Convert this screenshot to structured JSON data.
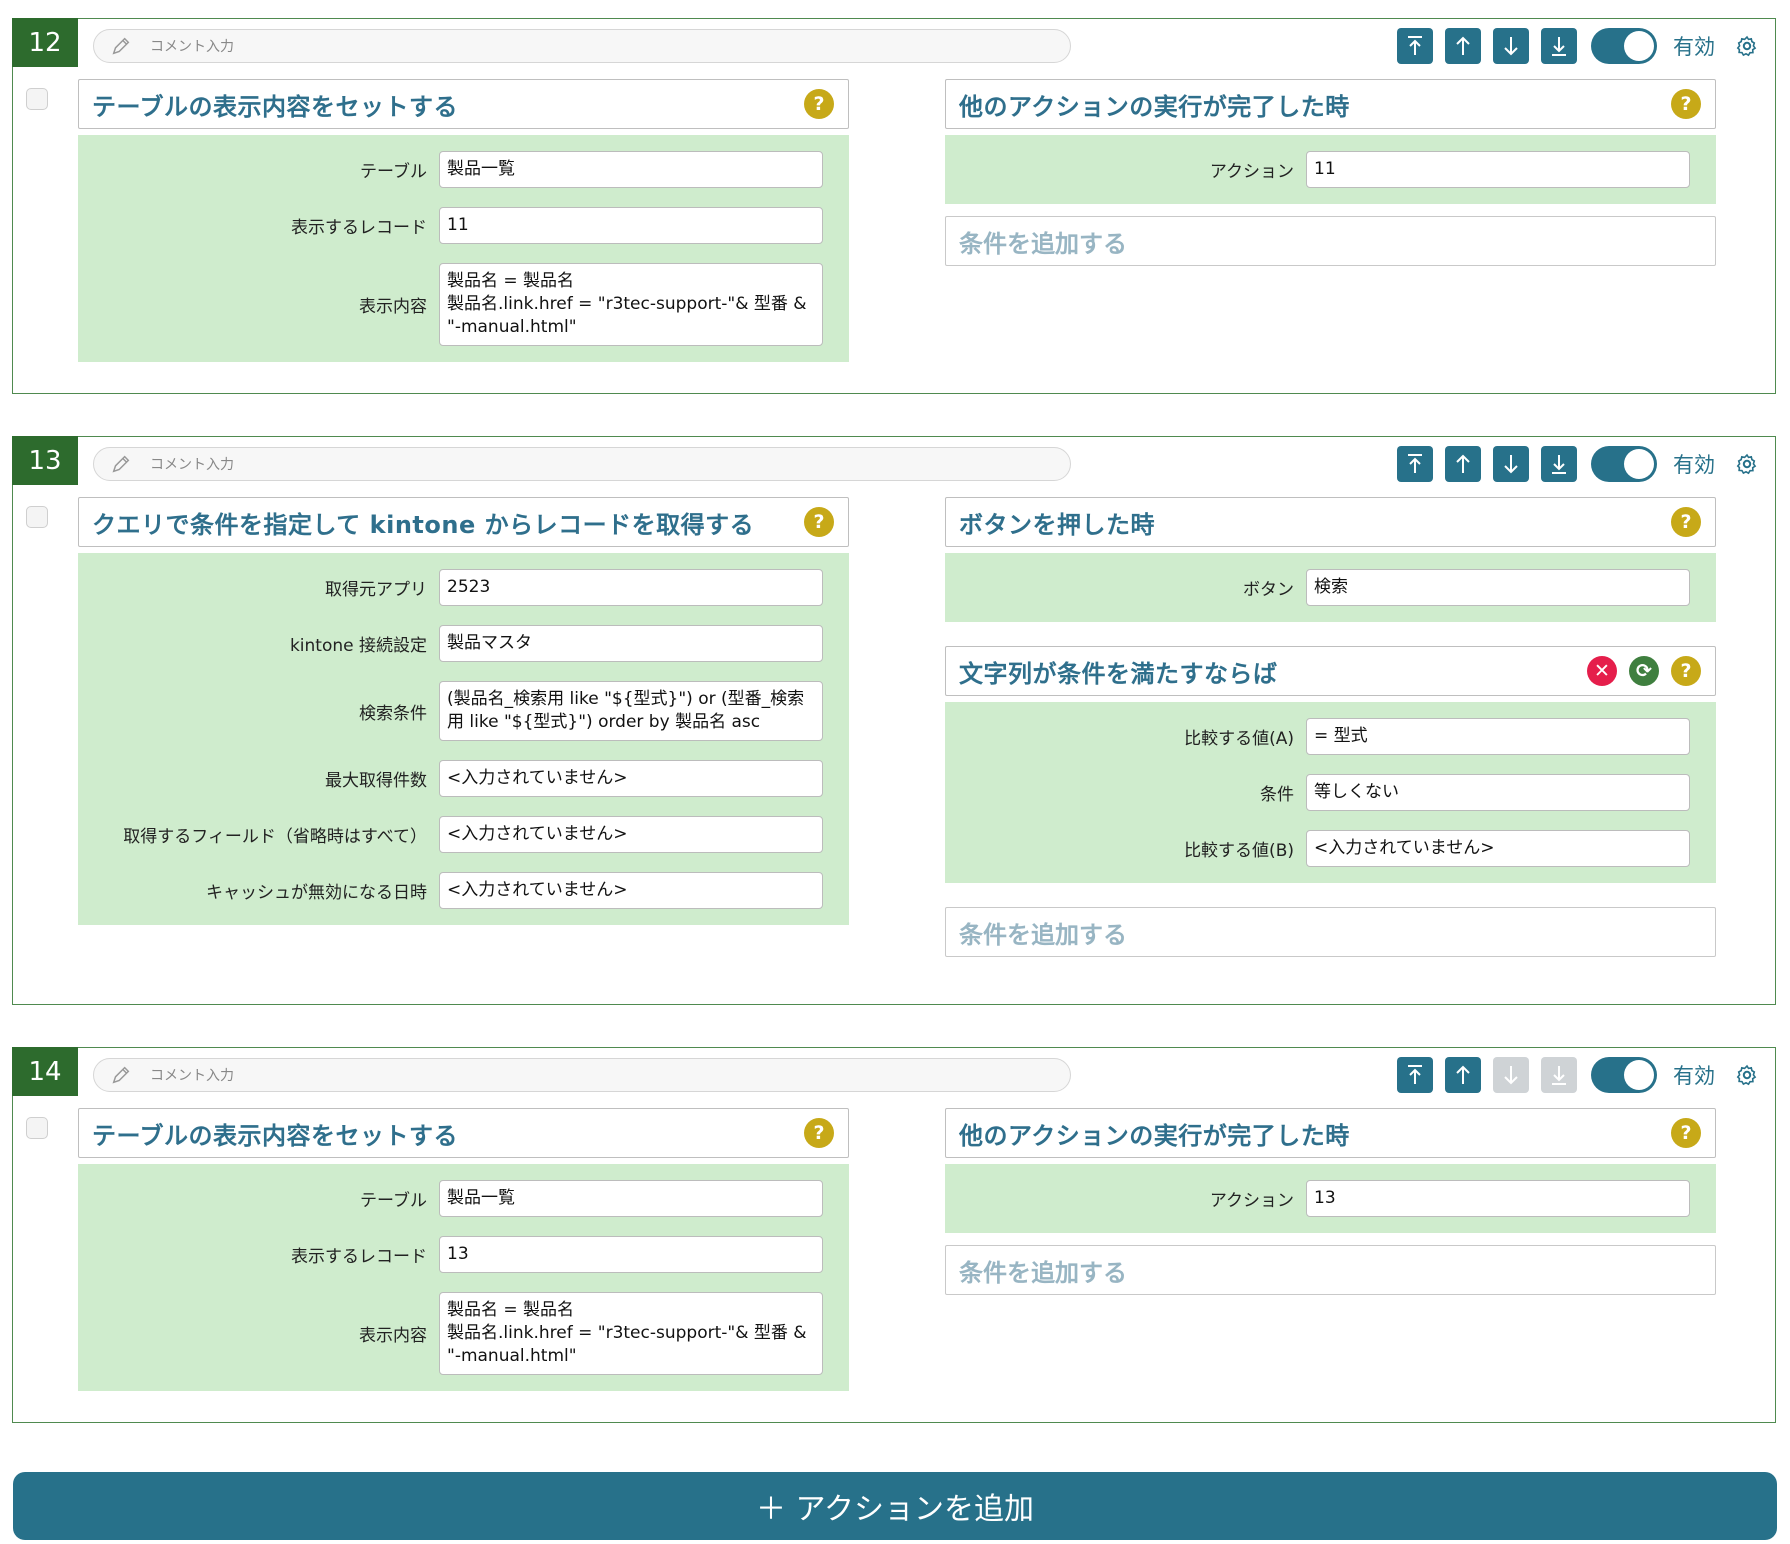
{
  "comment_placeholder": "コメント入力",
  "toggle_label": "有効",
  "add_condition_label": "条件を追加する",
  "add_action_label": "＋ アクションを追加",
  "colors": {
    "accent": "#27718a",
    "badge": "#2d6b2d",
    "panel_bg": "#cfeccd",
    "help": "#c7a918",
    "delete": "#e51e4b"
  },
  "actions": [
    {
      "number": "12",
      "enabled": true,
      "action": {
        "title": "テーブルの表示内容をセットする",
        "fields": [
          {
            "label": "テーブル",
            "value": "製品一覧"
          },
          {
            "label": "表示するレコード",
            "value": "11"
          },
          {
            "label": "表示内容",
            "value": "製品名 = 製品名\n製品名.link.href = \"r3tec-support-\"& 型番 & \"-manual.html\""
          }
        ]
      },
      "trigger": {
        "title": "他のアクションの実行が完了した時",
        "fields": [
          {
            "label": "アクション",
            "value": "11"
          }
        ]
      }
    },
    {
      "number": "13",
      "enabled": true,
      "action": {
        "title": "クエリで条件を指定して kintone からレコードを取得する",
        "fields": [
          {
            "label": "取得元アプリ",
            "value": "2523"
          },
          {
            "label": "kintone 接続設定",
            "value": "製品マスタ"
          },
          {
            "label": "検索条件",
            "value": "(製品名_検索用 like \"${型式}\") or (型番_検索用 like \"${型式}\") order by 製品名 asc"
          },
          {
            "label": "最大取得件数",
            "value": "<入力されていません>"
          },
          {
            "label": "取得するフィールド（省略時はすべて）",
            "value": "<入力されていません>"
          },
          {
            "label": "キャッシュが無効になる日時",
            "value": "<入力されていません>"
          }
        ]
      },
      "trigger": {
        "title": "ボタンを押した時",
        "fields": [
          {
            "label": "ボタン",
            "value": "検索"
          }
        ]
      },
      "condition": {
        "title": "文字列が条件を満たすならば",
        "fields": [
          {
            "label": "比較する値(A)",
            "value": "= 型式"
          },
          {
            "label": "条件",
            "value": "等しくない"
          },
          {
            "label": "比較する値(B)",
            "value": "<入力されていません>"
          }
        ]
      }
    },
    {
      "number": "14",
      "enabled": true,
      "action": {
        "title": "テーブルの表示内容をセットする",
        "fields": [
          {
            "label": "テーブル",
            "value": "製品一覧"
          },
          {
            "label": "表示するレコード",
            "value": "13"
          },
          {
            "label": "表示内容",
            "value": "製品名 = 製品名\n製品名.link.href = \"r3tec-support-\"& 型番 & \"-manual.html\""
          }
        ]
      },
      "trigger": {
        "title": "他のアクションの実行が完了した時",
        "fields": [
          {
            "label": "アクション",
            "value": "13"
          }
        ]
      }
    }
  ]
}
